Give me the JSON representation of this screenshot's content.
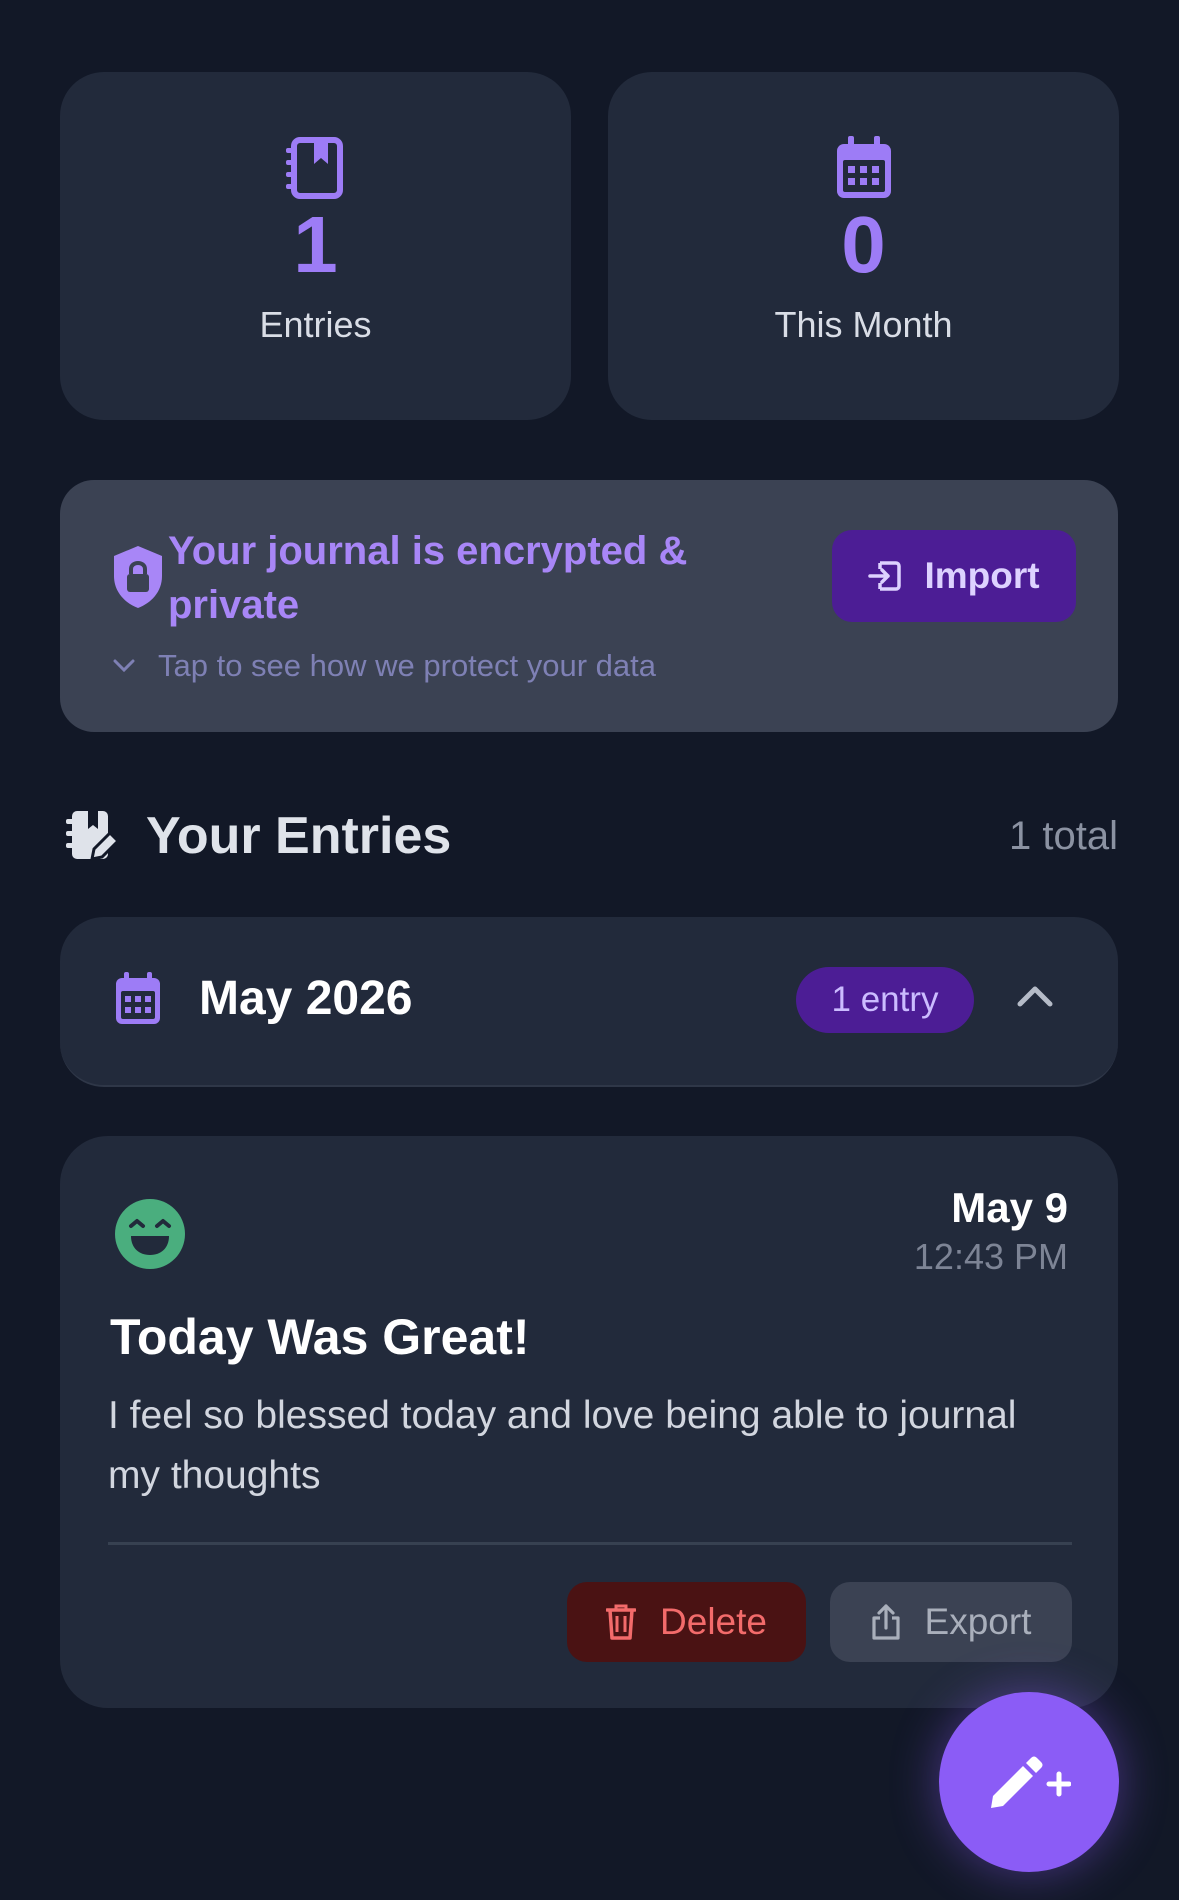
{
  "colors": {
    "background": "#121827",
    "card": "#222a3b",
    "accent": "#8b5cf6",
    "accent_text": "#9d7cf6",
    "badge_bg": "#4c1d95",
    "mood_happy": "#4aae7e",
    "danger": "#f36b6b"
  },
  "stats": {
    "entries": {
      "icon": "journal-icon",
      "value": "1",
      "label": "Entries"
    },
    "month": {
      "icon": "calendar-icon",
      "value": "0",
      "label": "This Month"
    }
  },
  "security": {
    "icon": "shield-lock-icon",
    "title": "Your journal is encrypted & private",
    "hint": "Tap to see how we protect your data",
    "import_label": "Import"
  },
  "section": {
    "icon": "journal-edit-icon",
    "title": "Your Entries",
    "count": "1 total"
  },
  "month_group": {
    "icon": "calendar-icon",
    "title": "May 2026",
    "badge": "1 entry",
    "expanded": true
  },
  "entry": {
    "mood_icon": "happy-face-icon",
    "date": "May 9",
    "time": "12:43 PM",
    "title": "Today Was Great!",
    "body": "I feel so blessed today and love being able to journal my thoughts",
    "delete_label": "Delete",
    "export_label": "Export"
  },
  "fab": {
    "icon": "pencil-plus-icon"
  }
}
